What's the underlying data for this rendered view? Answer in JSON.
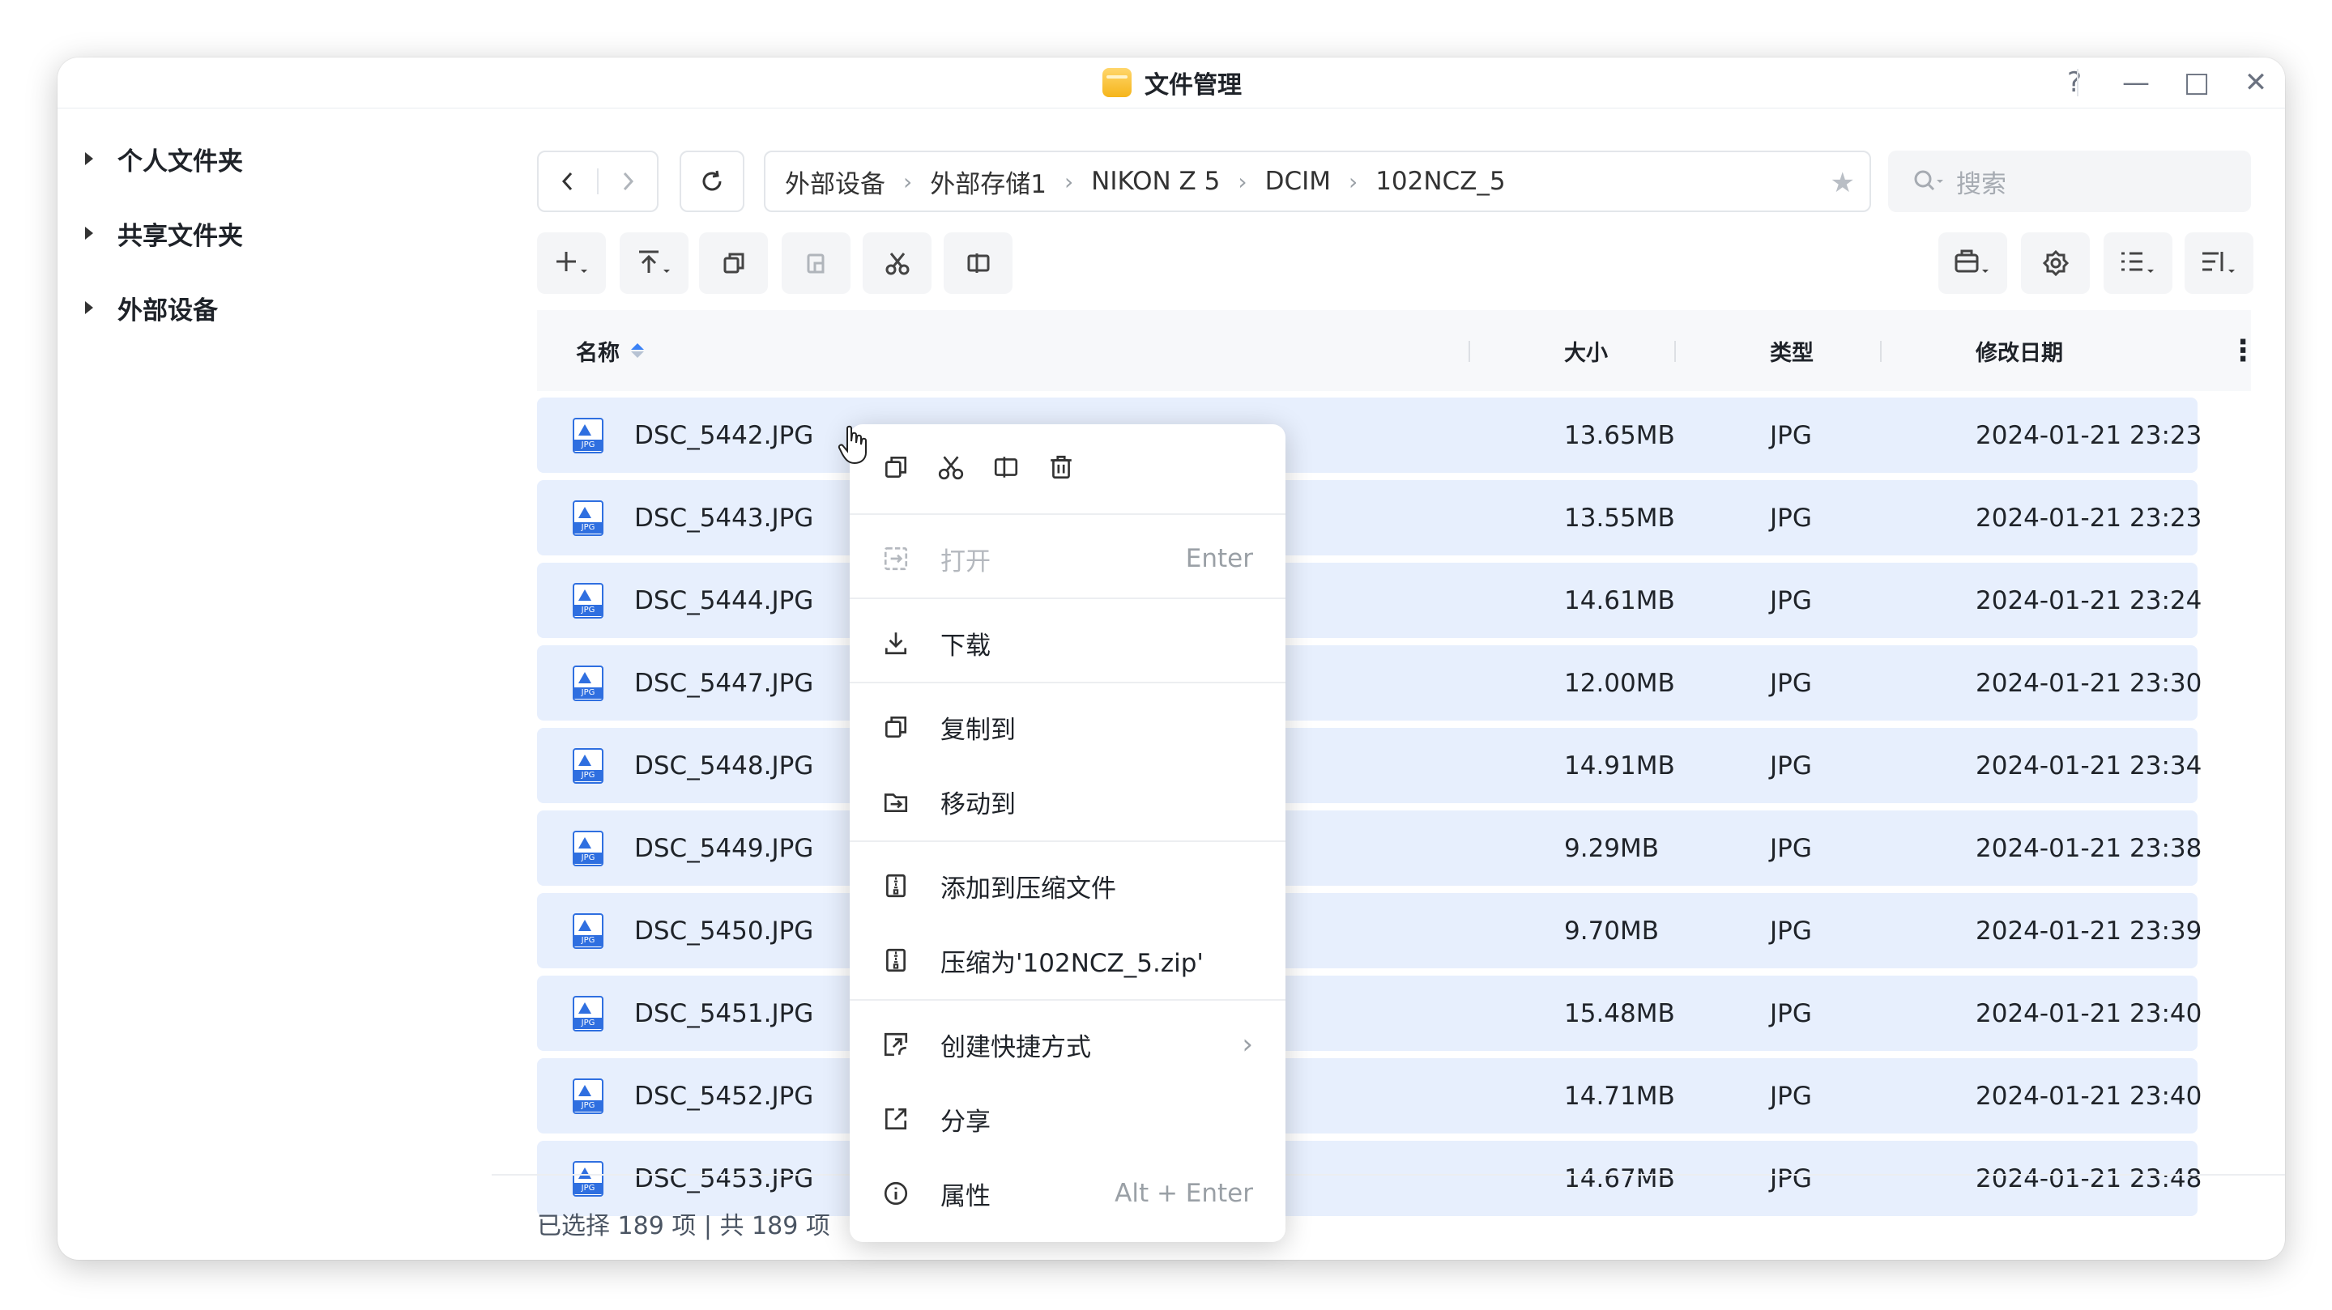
{
  "window": {
    "title": "文件管理"
  },
  "titlebar": {
    "help": "?",
    "minimize": "—",
    "maximize": "□",
    "close": "✕"
  },
  "sidebar": {
    "items": [
      {
        "label": "个人文件夹"
      },
      {
        "label": "共享文件夹"
      },
      {
        "label": "外部设备"
      }
    ]
  },
  "breadcrumb": [
    "外部设备",
    "外部存储1",
    "NIKON Z 5",
    "DCIM",
    "102NCZ_5"
  ],
  "search": {
    "placeholder": "搜索"
  },
  "table": {
    "headers": {
      "name": "名称",
      "size": "大小",
      "type": "类型",
      "modified": "修改日期"
    },
    "rows": [
      {
        "name": "DSC_5442.JPG",
        "size": "13.65MB",
        "type": "JPG",
        "modified": "2024-01-21 23:23"
      },
      {
        "name": "DSC_5443.JPG",
        "size": "13.55MB",
        "type": "JPG",
        "modified": "2024-01-21 23:23"
      },
      {
        "name": "DSC_5444.JPG",
        "size": "14.61MB",
        "type": "JPG",
        "modified": "2024-01-21 23:24"
      },
      {
        "name": "DSC_5447.JPG",
        "size": "12.00MB",
        "type": "JPG",
        "modified": "2024-01-21 23:30"
      },
      {
        "name": "DSC_5448.JPG",
        "size": "14.91MB",
        "type": "JPG",
        "modified": "2024-01-21 23:34"
      },
      {
        "name": "DSC_5449.JPG",
        "size": "9.29MB",
        "type": "JPG",
        "modified": "2024-01-21 23:38"
      },
      {
        "name": "DSC_5450.JPG",
        "size": "9.70MB",
        "type": "JPG",
        "modified": "2024-01-21 23:39"
      },
      {
        "name": "DSC_5451.JPG",
        "size": "15.48MB",
        "type": "JPG",
        "modified": "2024-01-21 23:40"
      },
      {
        "name": "DSC_5452.JPG",
        "size": "14.71MB",
        "type": "JPG",
        "modified": "2024-01-21 23:40"
      },
      {
        "name": "DSC_5453.JPG",
        "size": "14.67MB",
        "type": "JPG",
        "modified": "2024-01-21 23:48"
      }
    ]
  },
  "status": "已选择 189 项 | 共 189 项",
  "context_menu": {
    "open": {
      "label": "打开",
      "hint": "Enter"
    },
    "download": {
      "label": "下载"
    },
    "copy_to": {
      "label": "复制到"
    },
    "move_to": {
      "label": "移动到"
    },
    "add_to_archive": {
      "label": "添加到压缩文件"
    },
    "compress_as": {
      "label": "压缩为'102NCZ_5.zip'"
    },
    "create_shortcut": {
      "label": "创建快捷方式"
    },
    "share": {
      "label": "分享"
    },
    "properties": {
      "label": "属性",
      "hint": "Alt + Enter"
    }
  },
  "colors": {
    "accent": "#3b82f6",
    "selected_row": "#e7effd",
    "toolbar_bg": "#f4f5f7"
  }
}
